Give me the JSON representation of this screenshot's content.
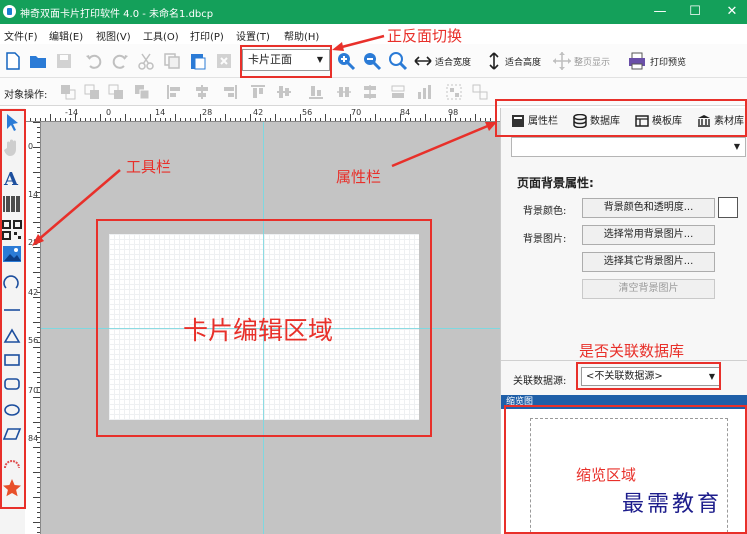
{
  "window": {
    "title": "神奇双面卡片打印软件 4.0 - 未命名1.dbcp",
    "controls": [
      "—",
      "☐",
      "✕"
    ]
  },
  "menu": [
    "文件(F)",
    "编辑(E)",
    "视图(V)",
    "工具(O)",
    "打印(P)",
    "设置(T)",
    "帮助(H)"
  ],
  "toolbar": {
    "side_select": "卡片正面",
    "fit_width": "适合宽度",
    "fit_height": "适合高度",
    "whole_page": "整页显示",
    "print_preview": "打印预览"
  },
  "alignbar": {
    "label": "对象操作:"
  },
  "ruler": {
    "h_ticks": [
      "-14",
      "0",
      "14",
      "28",
      "42",
      "56",
      "70",
      "84",
      "98"
    ],
    "v_ticks": [
      "0",
      "14",
      "28",
      "42",
      "56",
      "70",
      "84"
    ]
  },
  "panel": {
    "tabs": [
      "属性栏",
      "数据库",
      "模板库",
      "素材库"
    ],
    "section_title": "页面背景属性:",
    "bg_color_label": "背景颜色:",
    "bg_color_button": "背景颜色和透明度...",
    "bg_image_label": "背景图片:",
    "bg_common_button": "选择常用背景图片...",
    "bg_other_button": "选择其它背景图片...",
    "bg_clear_button": "清空背景图片",
    "datasource_label": "关联数据源:",
    "datasource_value": "<不关联数据源>",
    "thumbnail_header": "缩览图"
  },
  "annotations": {
    "toggle": "正反面切换",
    "toolbar": "工具栏",
    "property_bar": "属性栏",
    "edit_area": "卡片编辑区域",
    "database": "是否关联数据库",
    "thumbnail": "缩览区域"
  },
  "watermark": "最需教育",
  "colors": {
    "titlebar": "#14a05a",
    "annotation": "#e8302a",
    "canvas": "#c4c4c4"
  }
}
